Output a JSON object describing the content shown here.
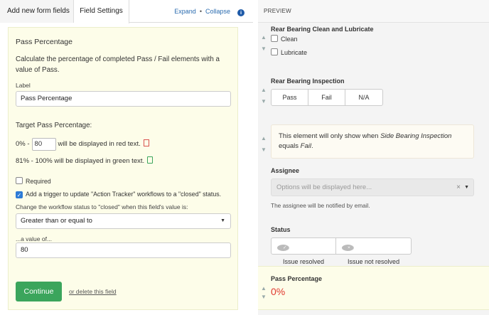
{
  "tabs": {
    "add_fields": "Add new form fields",
    "field_settings": "Field Settings"
  },
  "header_links": {
    "expand": "Expand",
    "dot": "•",
    "collapse": "Collapse",
    "info_glyph": "i"
  },
  "settings": {
    "title": "Pass Percentage",
    "description": "Calculate the percentage of completed Pass / Fail elements with a value of Pass.",
    "label_caption": "Label",
    "label_value": "Pass Percentage",
    "target_title": "Target Pass Percentage:",
    "range1_prefix": "0% -",
    "range1_value": "80",
    "range1_suffix": "will be displayed in red text.",
    "range2_text": "81% - 100% will be displayed in green text.",
    "required_label": "Required",
    "trigger_label": "Add a trigger to update \"Action Tracker\" workflows to a \"closed\" status.",
    "change_label": "Change the workflow status to \"closed\" when this field's value is:",
    "operator_selected": "Greater than or equal to",
    "value_caption": "...a value of...",
    "value_input": "80",
    "continue_label": "Continue",
    "delete_label": "or delete this field"
  },
  "preview": {
    "header": "PREVIEW",
    "up_glyph": "▲",
    "down_glyph": "▼",
    "rear_clean": {
      "title": "Rear Bearing Clean and Lubricate",
      "options": [
        "Clean",
        "Lubricate"
      ]
    },
    "rear_inspection": {
      "title": "Rear Bearing Inspection",
      "options": [
        "Pass",
        "Fail",
        "N/A"
      ]
    },
    "conditional": {
      "text1": "This element will only show when ",
      "italic1": "Side Bearing Inspection",
      "text2": "equals ",
      "italic2": "Fail",
      "end": "."
    },
    "assignee": {
      "title": "Assignee",
      "placeholder": "Options will be displayed here...",
      "clear": "×",
      "caret": "▼",
      "note": "The assignee will be notified by email."
    },
    "status": {
      "title": "Status",
      "check_glyph": "✓",
      "x_glyph": "×",
      "options": [
        "Issue resolved",
        "Issue not resolved"
      ]
    },
    "pass_pct": {
      "title": "Pass Percentage",
      "value": "0%"
    }
  },
  "colors": {
    "accent_blue": "#2b6cb0",
    "continue_green": "#3ba55c",
    "warn_red": "#e03a2f",
    "card_bg": "#fdfde9"
  }
}
